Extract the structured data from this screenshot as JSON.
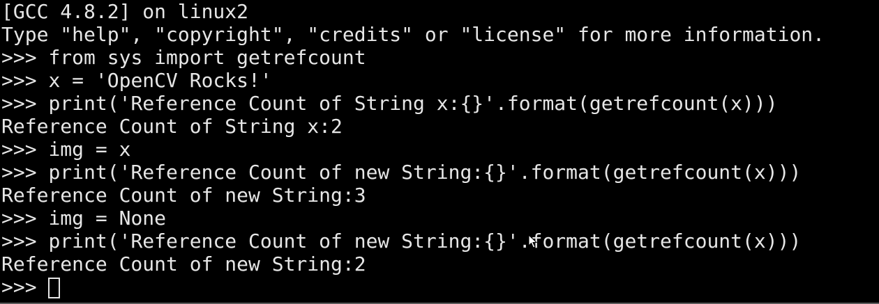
{
  "terminal": {
    "lines": [
      {
        "kind": "output",
        "text": "[GCC 4.8.2] on linux2"
      },
      {
        "kind": "output",
        "text": "Type \"help\", \"copyright\", \"credits\" or \"license\" for more information."
      },
      {
        "kind": "input",
        "prompt": ">>> ",
        "text": "from sys import getrefcount"
      },
      {
        "kind": "input",
        "prompt": ">>> ",
        "text": "x = 'OpenCV Rocks!'"
      },
      {
        "kind": "input",
        "prompt": ">>> ",
        "text": "print('Reference Count of String x:{}'.format(getrefcount(x)))"
      },
      {
        "kind": "output",
        "text": "Reference Count of String x:2"
      },
      {
        "kind": "input",
        "prompt": ">>> ",
        "text": "img = x"
      },
      {
        "kind": "input",
        "prompt": ">>> ",
        "text": "print('Reference Count of new String:{}'.format(getrefcount(x)))"
      },
      {
        "kind": "output",
        "text": "Reference Count of new String:3"
      },
      {
        "kind": "input",
        "prompt": ">>> ",
        "text": "img = None"
      },
      {
        "kind": "input",
        "prompt": ">>> ",
        "text": "print('Reference Count of new String:{}'.format(getrefcount(x)))"
      },
      {
        "kind": "output",
        "text": "Reference Count of new String:2"
      }
    ],
    "current_prompt": ">>> ",
    "current_input": "",
    "colors": {
      "background": "#000000",
      "foreground": "#e6e6e6"
    },
    "icons": {
      "cursor": "text-cursor-block-icon",
      "mouse": "mouse-pointer-icon"
    }
  }
}
